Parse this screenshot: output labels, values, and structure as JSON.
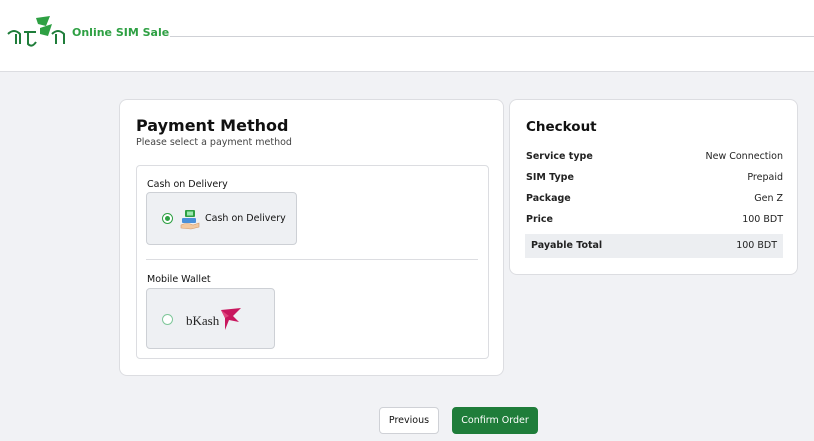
{
  "header": {
    "logo_icon": "sim-brand-logo-icon",
    "brand_name": "Online SIM Sale"
  },
  "payment": {
    "title": "Payment Method",
    "subtitle": "Please select a payment method",
    "groups": [
      {
        "label": "Cash on Delivery",
        "option_label": "Cash on Delivery",
        "selected": true,
        "icon": "cash-payment-icon"
      },
      {
        "label": "Mobile Wallet",
        "option_label": "bKash",
        "selected": false,
        "icon": "bkash-logo-icon"
      }
    ]
  },
  "checkout": {
    "title": "Checkout",
    "rows": [
      {
        "key": "Service type",
        "value": "New Connection"
      },
      {
        "key": "SIM Type",
        "value": "Prepaid"
      },
      {
        "key": "Package",
        "value": "Gen Z"
      },
      {
        "key": "Price",
        "value": "100 BDT"
      }
    ],
    "total": {
      "key": "Payable Total",
      "value": "100 BDT"
    }
  },
  "actions": {
    "previous_label": "Previous",
    "confirm_label": "Confirm Order"
  },
  "colors": {
    "accent_green": "#2ea043",
    "button_green": "#1f7d3a",
    "bkash_pink": "#c8175e"
  }
}
